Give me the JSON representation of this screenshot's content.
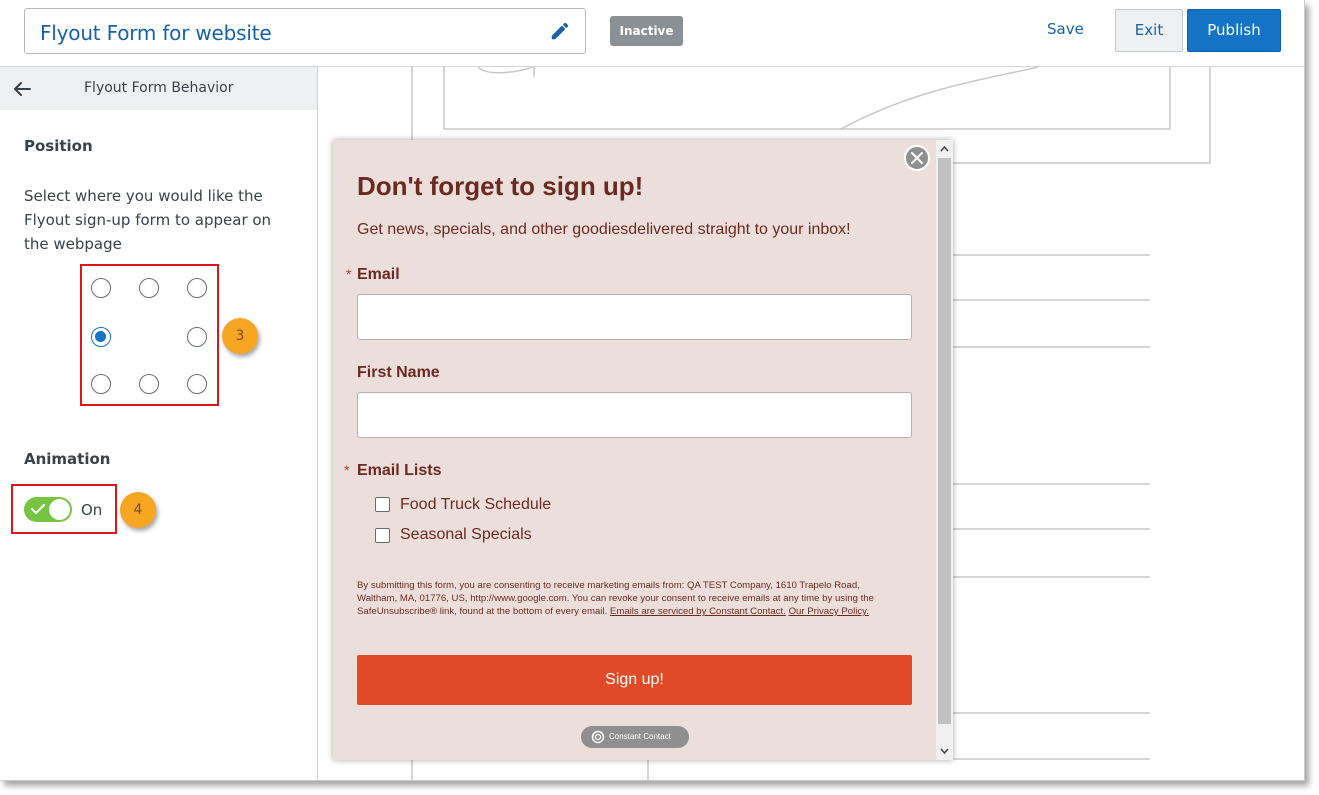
{
  "header": {
    "form_title": "Flyout Form for website",
    "status": "Inactive",
    "save_label": "Save",
    "exit_label": "Exit",
    "publish_label": "Publish"
  },
  "sidebar": {
    "title": "Flyout Form Behavior",
    "position_heading": "Position",
    "position_description": "Select where you would like the Flyout sign-up form to appear on the webpage",
    "position_selected": "middle-left",
    "callout_position": "3",
    "animation_heading": "Animation",
    "animation_state": "On",
    "animation_enabled": true,
    "callout_animation": "4"
  },
  "flyout": {
    "title": "Don't forget to sign up!",
    "subtitle": "Get news, specials, and other goodiesdelivered straight to your inbox!",
    "required_marker": "*",
    "email_label": "Email",
    "first_name_label": "First Name",
    "lists_label": "Email Lists",
    "lists": [
      {
        "label": "Food Truck Schedule",
        "checked": false
      },
      {
        "label": "Seasonal Specials",
        "checked": false
      }
    ],
    "legal_text": "By submitting this form, you are consenting to receive marketing emails from: QA TEST Company, 1610 Trapelo Road, Waltham, MA, 01776, US, http://www.google.com. You can revoke your consent to receive emails at any time by using the SafeUnsubscribe® link, found at the bottom of every email.",
    "legal_link_service": "Emails are serviced by Constant Contact.",
    "legal_link_privacy": "Our Privacy Policy.",
    "submit_label": "Sign up!",
    "brand_badge": "Constant Contact"
  },
  "colors": {
    "accent_blue": "#1473c4",
    "status_gray": "#8a9094",
    "toggle_green": "#76c442",
    "callout_orange": "#f6a623",
    "highlight_red": "#e0141c",
    "flyout_bg": "#ecdfdb",
    "flyout_text": "#6a2a20",
    "submit_orange": "#e04a27"
  },
  "icons": [
    "pencil-icon",
    "back-arrow-icon",
    "check-icon",
    "close-icon",
    "constant-contact-icon",
    "scroll-up-icon",
    "scroll-down-icon"
  ]
}
